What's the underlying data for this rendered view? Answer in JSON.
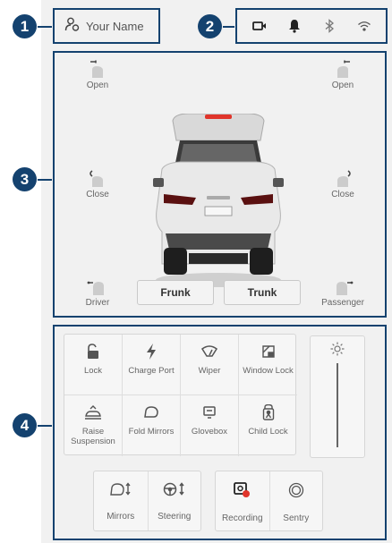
{
  "callouts": [
    "1",
    "2",
    "3",
    "4"
  ],
  "profile": {
    "name": "Your Name",
    "icon": "user-icon"
  },
  "status_icons": [
    "dashcam-icon",
    "bell-icon",
    "bluetooth-icon",
    "wifi-icon"
  ],
  "doors": {
    "front_left": "Open",
    "front_right": "Open",
    "rear_left": "Close",
    "rear_right": "Close",
    "driver": "Driver",
    "passenger": "Passenger"
  },
  "buttons": {
    "frunk": "Frunk",
    "trunk": "Trunk"
  },
  "controls": [
    {
      "label": "Lock",
      "icon": "unlock-icon"
    },
    {
      "label": "Charge Port",
      "icon": "bolt-icon"
    },
    {
      "label": "Wiper",
      "icon": "wiper-icon"
    },
    {
      "label": "Window Lock",
      "icon": "window-lock-icon"
    },
    {
      "label": "Raise Suspension",
      "icon": "suspension-icon"
    },
    {
      "label": "Fold Mirrors",
      "icon": "mirror-icon"
    },
    {
      "label": "Glovebox",
      "icon": "glovebox-icon"
    },
    {
      "label": "Child Lock",
      "icon": "child-lock-icon"
    }
  ],
  "brightness": {
    "icon": "sun-icon"
  },
  "adjust": {
    "mirrors": "Mirrors",
    "steering": "Steering"
  },
  "security": {
    "recording": "Recording",
    "sentry": "Sentry"
  },
  "colors": {
    "callout": "#14426f",
    "accent": "#e0352b",
    "background": "#f1f1f1"
  }
}
